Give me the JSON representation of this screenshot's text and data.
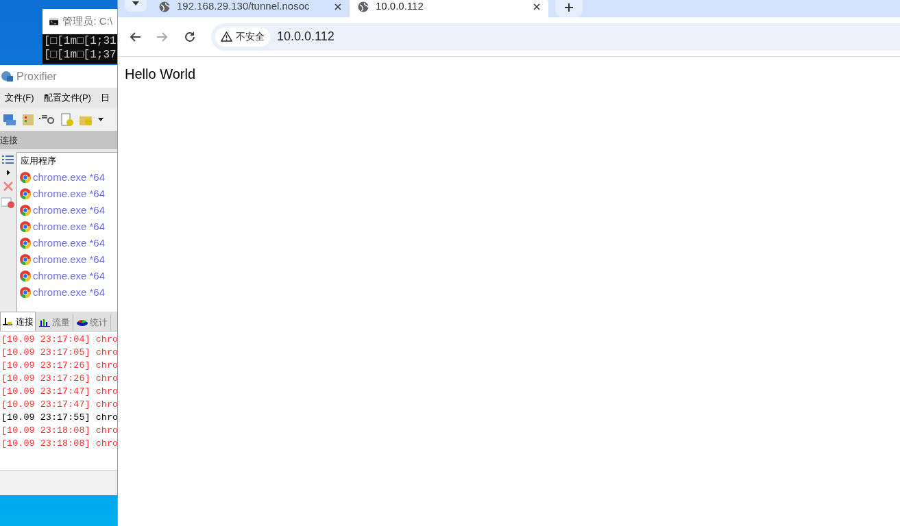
{
  "console_window": {
    "title": "管理员: C:\\",
    "lines": [
      "[□[1m□[1;31",
      "[□[1m□[1;37"
    ]
  },
  "proxifier": {
    "title": "Proxifier",
    "menu": [
      "文件(F)",
      "配置文件(P)",
      "日"
    ],
    "section_header": "连接",
    "list_header": "应用程序",
    "apps": [
      {
        "name": "chrome.exe *64"
      },
      {
        "name": "chrome.exe *64"
      },
      {
        "name": "chrome.exe *64"
      },
      {
        "name": "chrome.exe *64"
      },
      {
        "name": "chrome.exe *64"
      },
      {
        "name": "chrome.exe *64"
      },
      {
        "name": "chrome.exe *64"
      },
      {
        "name": "chrome.exe *64"
      }
    ],
    "tabs": [
      {
        "label": "连接",
        "selected": true
      },
      {
        "label": "流量",
        "selected": false
      },
      {
        "label": "统计",
        "selected": false
      }
    ],
    "log": [
      {
        "text": "[10.09 23:17:04] chro",
        "error": true
      },
      {
        "text": "[10.09 23:17:05] chro",
        "error": true
      },
      {
        "text": "[10.09 23:17:26] chro",
        "error": true
      },
      {
        "text": "[10.09 23:17:26] chro",
        "error": true
      },
      {
        "text": "[10.09 23:17:47] chro",
        "error": true
      },
      {
        "text": "[10.09 23:17:47] chro",
        "error": true
      },
      {
        "text": "[10.09 23:17:55] chro",
        "error": false
      },
      {
        "text": "[10.09 23:18:08] chro",
        "error": true
      },
      {
        "text": "[10.09 23:18:08] chro",
        "error": true
      }
    ]
  },
  "browser": {
    "tabs": [
      {
        "title": "192.168.29.130/tunnel.nosoc",
        "selected": false
      },
      {
        "title": "10.0.0.112",
        "selected": true
      }
    ],
    "security_chip": "不安全",
    "url": "10.0.0.112",
    "page_text": "Hello World"
  }
}
